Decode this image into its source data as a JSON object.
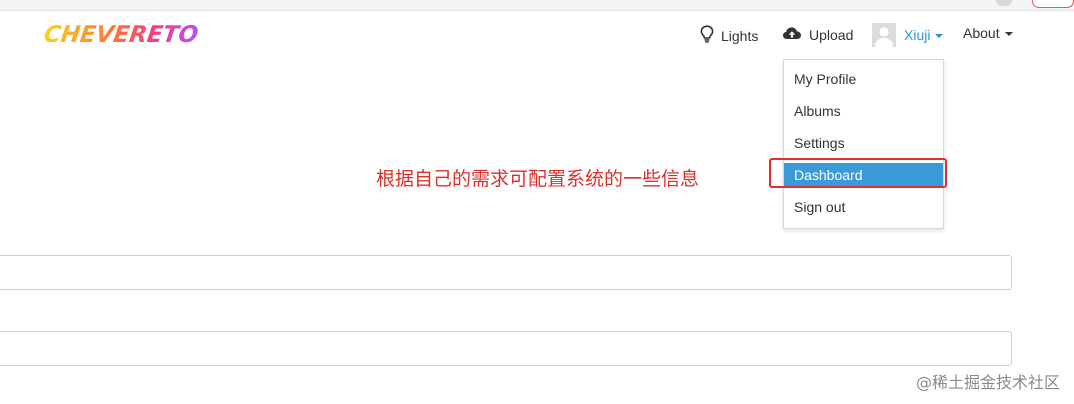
{
  "logo": {
    "text": "CHEVERETO"
  },
  "nav": {
    "lights_label": "Lights",
    "upload_label": "Upload",
    "user_name": "Xiuji",
    "about_label": "About"
  },
  "user_menu": {
    "items": [
      {
        "label": "My Profile"
      },
      {
        "label": "Albums"
      },
      {
        "label": "Settings"
      },
      {
        "label": "Dashboard",
        "active": true
      },
      {
        "label": "Sign out"
      }
    ]
  },
  "annotation": {
    "text": "根据自己的需求可配置系统的一些信息"
  },
  "watermark": {
    "text": "@稀土掘金技术社区"
  },
  "colors": {
    "accent": "#3b9ad9",
    "user_link": "#2f93d5",
    "annotation_red": "#d9312a"
  }
}
